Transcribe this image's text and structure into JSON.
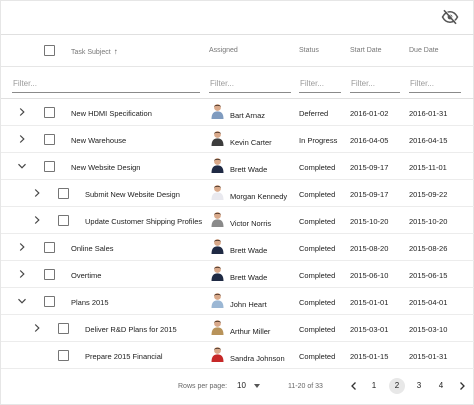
{
  "columns": {
    "subject": "Task Subject",
    "assigned": "Assigned",
    "status": "Status",
    "start": "Start Date",
    "due": "Due Date"
  },
  "filter_placeholder": "Filter...",
  "rows": [
    {
      "subject": "New HDMI Specification",
      "assigned": "Bart Arnaz",
      "status": "Deferred",
      "start": "2016-01-02",
      "due": "2016-01-31",
      "expander": "chevron-right-icon",
      "avatar_shirt": "#7f9bbf"
    },
    {
      "subject": "New Warehouse",
      "assigned": "Kevin Carter",
      "status": "In Progress",
      "start": "2016-04-05",
      "due": "2016-04-15",
      "expander": "chevron-right-icon",
      "avatar_shirt": "#3d3d3d"
    },
    {
      "subject": "New Website Design",
      "assigned": "Brett Wade",
      "status": "Completed",
      "start": "2015-09-17",
      "due": "2015-11-01",
      "expander": "chevron-down-icon",
      "avatar_shirt": "#1f2a44"
    },
    {
      "subject": "Submit New Website Design",
      "assigned": "Morgan Kennedy",
      "status": "Completed",
      "start": "2015-09-17",
      "due": "2015-09-22",
      "expander": "chevron-right-icon",
      "avatar_shirt": "#e9e9ef"
    },
    {
      "subject": "Update Customer Shipping Profiles",
      "assigned": "Victor Norris",
      "status": "Completed",
      "start": "2015-10-20",
      "due": "2015-10-20",
      "expander": "chevron-right-icon",
      "avatar_shirt": "#8a8a8a"
    },
    {
      "subject": "Online Sales",
      "assigned": "Brett Wade",
      "status": "Completed",
      "start": "2015-08-20",
      "due": "2015-08-26",
      "expander": "chevron-right-icon",
      "avatar_shirt": "#1f2a44"
    },
    {
      "subject": "Overtime",
      "assigned": "Brett Wade",
      "status": "Completed",
      "start": "2015-06-10",
      "due": "2015-06-15",
      "expander": "chevron-right-icon",
      "avatar_shirt": "#1f2a44"
    },
    {
      "subject": "Plans 2015",
      "assigned": "John Heart",
      "status": "Completed",
      "start": "2015-01-01",
      "due": "2015-04-01",
      "expander": "chevron-down-icon",
      "avatar_shirt": "#9bb7d4"
    },
    {
      "subject": "Deliver R&D Plans for 2015",
      "assigned": "Arthur Miller",
      "status": "Completed",
      "start": "2015-03-01",
      "due": "2015-03-10",
      "expander": "chevron-right-icon",
      "avatar_shirt": "#b8935a"
    },
    {
      "subject": "Prepare 2015 Financial",
      "assigned": "Sandra Johnson",
      "status": "Completed",
      "start": "2015-01-15",
      "due": "2015-01-31",
      "expander": "",
      "avatar_shirt": "#c62828"
    }
  ],
  "pagination": {
    "rows_per_page_label": "Rows per page:",
    "rows_per_page": "10",
    "range": "11-20 of 33",
    "pages": [
      "1",
      "2",
      "3",
      "4"
    ],
    "active_page": "2"
  },
  "colors": {
    "border": "#e0e0e0",
    "text": "#212121",
    "muted": "#777777"
  }
}
